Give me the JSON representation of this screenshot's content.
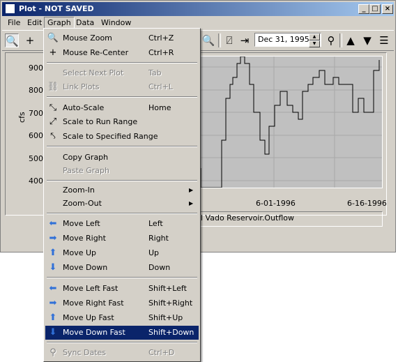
{
  "window": {
    "title": "Plot - NOT SAVED"
  },
  "menubar": [
    "File",
    "Edit",
    "Graph",
    "Data",
    "Window"
  ],
  "toolbar": {
    "date_value": "Dec 31, 1995"
  },
  "plot": {
    "ylabel": "cfs",
    "yticks": [
      "900.",
      "800.",
      "700.",
      "600.",
      "500.",
      "400."
    ],
    "xticks": [
      "6-01-1996",
      "6-16-1996"
    ],
    "legend_text": "l Vado Reservoir.Outflow"
  },
  "menu": {
    "items": [
      {
        "label": "Mouse Zoom",
        "shortcut": "Ctrl+Z",
        "icon": "magnifier-icon",
        "enabled": true
      },
      {
        "label": "Mouse Re-Center",
        "shortcut": "Ctrl+R",
        "icon": "crosshair-icon",
        "enabled": true
      },
      {
        "label": "Select Next Plot",
        "shortcut": "Tab",
        "icon": "",
        "enabled": false
      },
      {
        "label": "Link Plots",
        "shortcut": "Ctrl+L",
        "icon": "link-icon",
        "enabled": false
      },
      {
        "label": "Auto-Scale",
        "shortcut": "Home",
        "icon": "autoscale-icon",
        "enabled": true
      },
      {
        "label": "Scale to Run Range",
        "shortcut": "",
        "icon": "run-range-icon",
        "enabled": true
      },
      {
        "label": "Scale to Specified Range",
        "shortcut": "",
        "icon": "specified-range-icon",
        "enabled": true
      },
      {
        "label": "Copy Graph",
        "shortcut": "",
        "icon": "",
        "enabled": true
      },
      {
        "label": "Paste Graph",
        "shortcut": "",
        "icon": "",
        "enabled": false
      },
      {
        "label": "Zoom-In",
        "shortcut": "",
        "icon": "",
        "enabled": true,
        "submenu": true
      },
      {
        "label": "Zoom-Out",
        "shortcut": "",
        "icon": "",
        "enabled": true,
        "submenu": true
      },
      {
        "label": "Move Left",
        "shortcut": "Left",
        "icon": "arrow-left-icon",
        "enabled": true
      },
      {
        "label": "Move Right",
        "shortcut": "Right",
        "icon": "arrow-right-icon",
        "enabled": true
      },
      {
        "label": "Move Up",
        "shortcut": "Up",
        "icon": "arrow-up-icon",
        "enabled": true
      },
      {
        "label": "Move Down",
        "shortcut": "Down",
        "icon": "arrow-down-icon",
        "enabled": true
      },
      {
        "label": "Move Left Fast",
        "shortcut": "Shift+Left",
        "icon": "arrow-left-fast-icon",
        "enabled": true
      },
      {
        "label": "Move Right Fast",
        "shortcut": "Shift+Right",
        "icon": "arrow-right-fast-icon",
        "enabled": true
      },
      {
        "label": "Move Up Fast",
        "shortcut": "Shift+Up",
        "icon": "arrow-up-fast-icon",
        "enabled": true
      },
      {
        "label": "Move Down Fast",
        "shortcut": "Shift+Down",
        "icon": "arrow-down-fast-icon",
        "enabled": true,
        "selected": true
      },
      {
        "label": "Sync Dates",
        "shortcut": "Ctrl+D",
        "icon": "sync-icon",
        "enabled": false
      }
    ]
  },
  "colors": {
    "selection": "#0a246a",
    "face": "#d4d0c8",
    "plot_bg": "#c0c0c0",
    "titlebar": "#0a246a"
  }
}
